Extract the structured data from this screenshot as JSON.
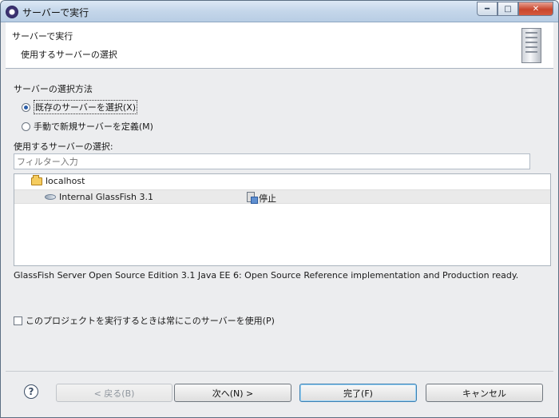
{
  "window": {
    "title": "サーバーで実行",
    "minimize_icon": "minimize-icon",
    "maximize_icon": "maximize-icon",
    "close_icon": "close-icon"
  },
  "banner": {
    "title": "サーバーで実行",
    "description": "使用するサーバーの選択",
    "icon": "server-icon"
  },
  "selection": {
    "method_label": "サーバーの選択方法",
    "existing_option": "既存のサーバーを選択(X)",
    "manual_option": "手動で新規サーバーを定義(M)",
    "selected_method": "existing"
  },
  "server_list": {
    "label": "使用するサーバーの選択:",
    "filter_placeholder": "フィルター入力",
    "host": "localhost",
    "server_name": "Internal GlassFish 3.1",
    "state": "停止"
  },
  "description": "GlassFish Server Open Source Edition 3.1 Java EE 6: Open Source Reference implementation and Production ready.",
  "project_option": {
    "label": "このプロジェクトを実行するときは常にこのサーバーを使用(P)",
    "checked": false
  },
  "footer": {
    "help_icon": "help-icon",
    "back_label": "< 戻る(B)",
    "next_label": "次へ(N) >",
    "finish_label": "完了(F)",
    "cancel_label": "キャンセル"
  },
  "colors": {
    "titlebar": "#c4d6ea",
    "dialog_background": "#ecedef",
    "selected_row": "#eaeaea",
    "close_button": "#c9462c"
  }
}
